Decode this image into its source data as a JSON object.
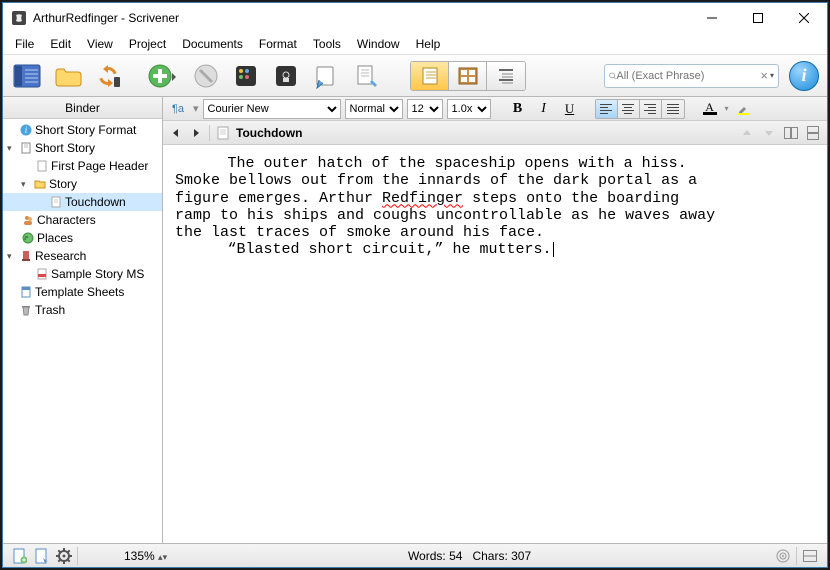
{
  "window": {
    "title": "ArthurRedfinger - Scrivener"
  },
  "menu": {
    "file": "File",
    "edit": "Edit",
    "view": "View",
    "project": "Project",
    "documents": "Documents",
    "format": "Format",
    "tools": "Tools",
    "window": "Window",
    "help": "Help"
  },
  "toolbar": {
    "search_placeholder": "All (Exact Phrase)"
  },
  "binder": {
    "header": "Binder",
    "items": {
      "short_story_format": "Short Story Format",
      "short_story": "Short Story",
      "first_page_header": "First Page Header",
      "story": "Story",
      "touchdown": "Touchdown",
      "characters": "Characters",
      "places": "Places",
      "research": "Research",
      "sample_story_ms": "Sample Story MS",
      "template_sheets": "Template Sheets",
      "trash": "Trash"
    }
  },
  "format": {
    "font": "Courier New",
    "style": "Normal",
    "size": "12",
    "spacing": "1.0x"
  },
  "doc": {
    "title": "Touchdown",
    "para1_a": "The outer hatch of the spaceship opens with a hiss.",
    "para1_b": "Smoke bellows out from the innards of the dark portal as a",
    "para1_c_pre": "figure emerges. Arthur ",
    "para1_c_err": "Redfinger",
    "para1_c_post": " steps onto the boarding",
    "para1_d": "ramp to his ships and coughs uncontrollable as he waves away",
    "para1_e": "the last traces of smoke around his face.",
    "para2": "“Blasted short circuit,” he mutters."
  },
  "status": {
    "zoom": "135%",
    "words_label": "Words:",
    "words": "54",
    "chars_label": "Chars:",
    "chars": "307"
  }
}
